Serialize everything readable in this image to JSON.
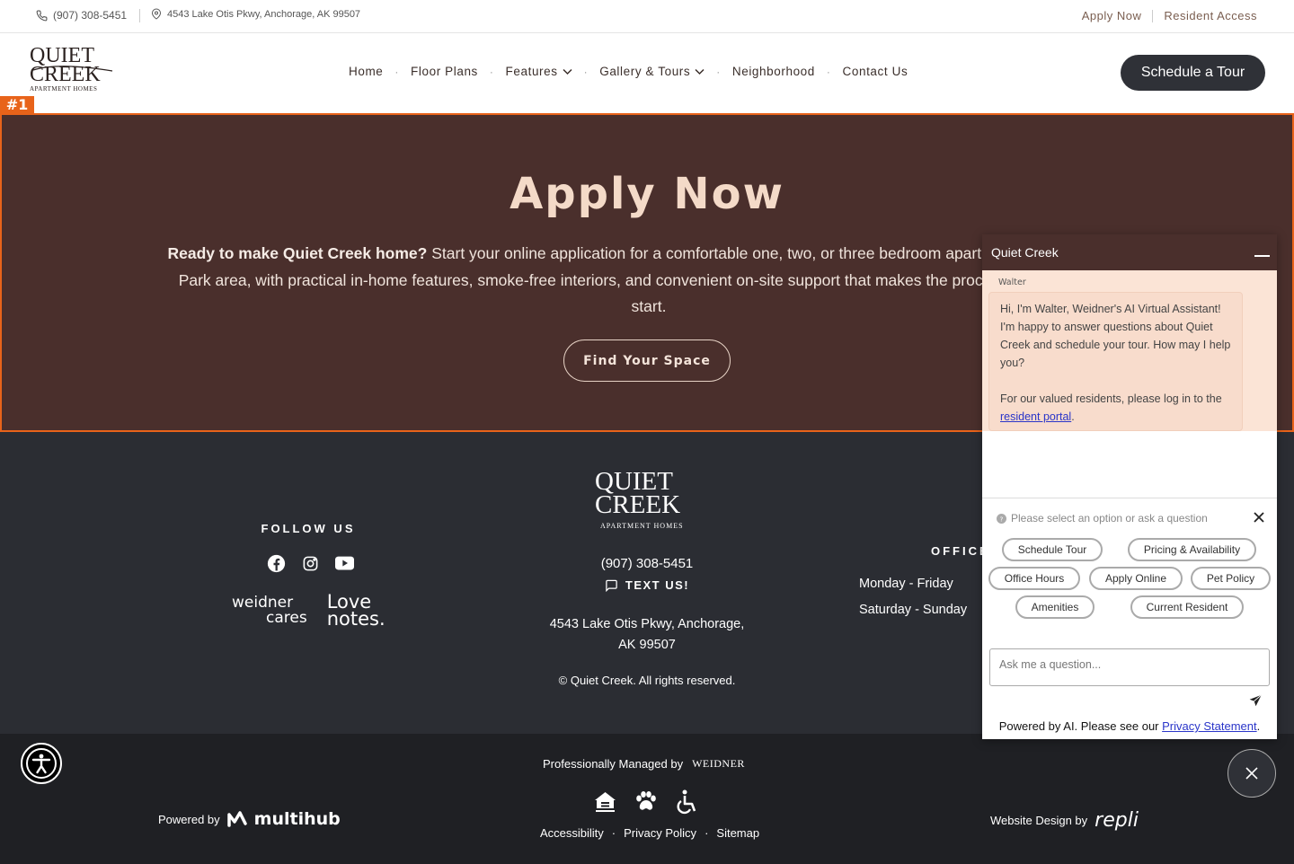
{
  "topbar": {
    "phone": "(907) 308-5451",
    "address": "4543 Lake Otis Pkwy, Anchorage, AK 99507",
    "apply_now": "Apply Now",
    "resident_access": "Resident Access"
  },
  "header": {
    "logo_line1": "QUIET",
    "logo_line2": "CREEK",
    "logo_line3": "APARTMENT HOMES",
    "nav": {
      "home": "Home",
      "floor_plans": "Floor Plans",
      "features": "Features",
      "gallery": "Gallery & Tours",
      "neighborhood": "Neighborhood",
      "contact": "Contact Us"
    },
    "cta": "Schedule a Tour"
  },
  "hero": {
    "tag": "#1",
    "title": "Apply Now",
    "lead": "Ready to make Quiet Creek home?",
    "body": " Start your online application for a comfortable one, two, or three bedroom apartment in the Campbell Park area, with practical in-home features, smoke-free interiors, and convenient on-site support that makes the process simple from the start.",
    "button": "Find Your Space"
  },
  "footer": {
    "follow_us": "FOLLOW US",
    "weidner_cares_line1": "weidner",
    "weidner_cares_line2": "cares",
    "love_notes_line1": "Love",
    "love_notes_line2": "notes.",
    "logo_line1": "QUIET",
    "logo_line2": "CREEK",
    "logo_line3": "APARTMENT HOMES",
    "phone": "(907) 308-5451",
    "text_us": "TEXT US!",
    "address_line1": "4543 Lake Otis Pkwy, Anchorage,",
    "address_line2": "AK 99507",
    "copyright": "© Quiet Creek. All rights reserved.",
    "office_heading": "OFFICE",
    "hours_weekday": "Monday - Friday",
    "hours_weekend": "Saturday - Sunday"
  },
  "bottom": {
    "managed_by": "Professionally Managed by",
    "weidner_logo": "WEIDNER",
    "links": {
      "accessibility": "Accessibility",
      "privacy": "Privacy Policy",
      "sitemap": "Sitemap"
    },
    "powered_by": "Powered by",
    "multihub": "multihub",
    "design_by": "Website Design by",
    "repli": "repli"
  },
  "chat": {
    "title": "Quiet Creek",
    "agent_name": "Walter",
    "message": "Hi, I'm Walter, Weidner's AI Virtual Assistant! I'm happy to answer questions about Quiet Creek and schedule your tour. How may I help you?",
    "resident_msg": "For our valued residents, please log in to the ",
    "resident_link": "resident portal",
    "prompt": "Please select an option or ask a question",
    "chips": {
      "schedule_tour": "Schedule Tour",
      "pricing": "Pricing & Availability",
      "office_hours": "Office Hours",
      "apply_online": "Apply Online",
      "pet_policy": "Pet Policy",
      "amenities": "Amenities",
      "current_resident": "Current Resident"
    },
    "input_placeholder": "Ask me a question...",
    "powered_text": "Powered by AI. Please see our ",
    "privacy_link": "Privacy Statement"
  },
  "colors": {
    "hero_bg": "#4a2f2c",
    "footer_bg": "#2b2d33",
    "highlight": "#e8631a",
    "chat_bubble": "#f8dccc"
  }
}
